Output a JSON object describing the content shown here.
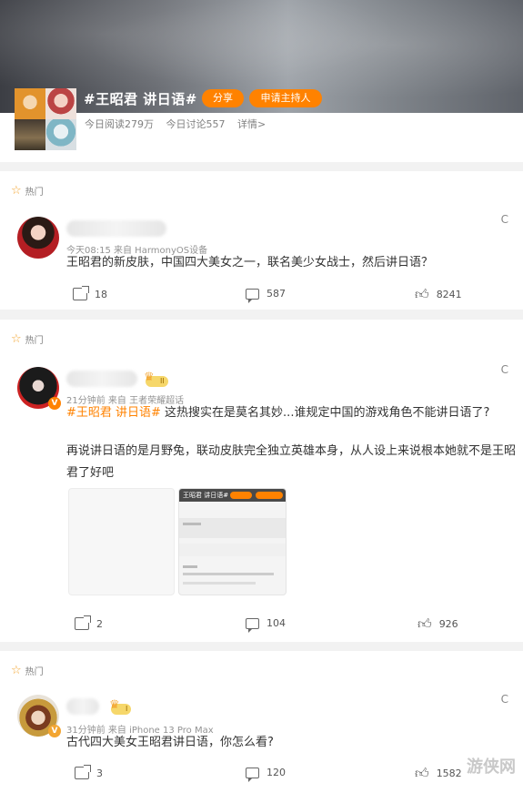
{
  "topic": {
    "title": "#王昭君 讲日语#",
    "share_label": "分享",
    "host_label": "申请主持人",
    "read_today": "今日阅读279万",
    "discuss_today": "今日讨论557",
    "detail_link": "详情>"
  },
  "posts": [
    {
      "hot_label": "热门",
      "meta": "今天08:15 来自 HarmonyOS设备",
      "content": "王昭君的新皮肤，中国四大美女之一，联名美少女战士，然后讲日语？",
      "reposts": "18",
      "comments": "587",
      "likes": "8241",
      "c_mark": "C"
    },
    {
      "hot_label": "热门",
      "level": "II",
      "meta": "21分钟前 来自 王者荣耀超话",
      "hashtag": "#王昭君 讲日语#",
      "content_line1": " 这热搜实在是莫名其妙...谁规定中国的游戏角色不能讲日语了?",
      "content_line2": "再说讲日语的是月野兔，联动皮肤完全独立英雄本身，从人设上来说根本她就不是王昭",
      "content_line3": "君了好吧",
      "img_topic": "王昭君 讲日语#",
      "reposts": "2",
      "comments": "104",
      "likes": "926",
      "c_mark": "C"
    },
    {
      "hot_label": "热门",
      "level": "I",
      "meta": "31分钟前 来自 iPhone 13 Pro Max",
      "content": "古代四大美女王昭君讲日语，你怎么看?",
      "reposts": "3",
      "comments": "120",
      "likes": "1582",
      "c_mark": "C"
    }
  ],
  "watermark": "游侠网",
  "colors": {
    "accent": "#ff8200",
    "hot_star": "#f3a531"
  }
}
